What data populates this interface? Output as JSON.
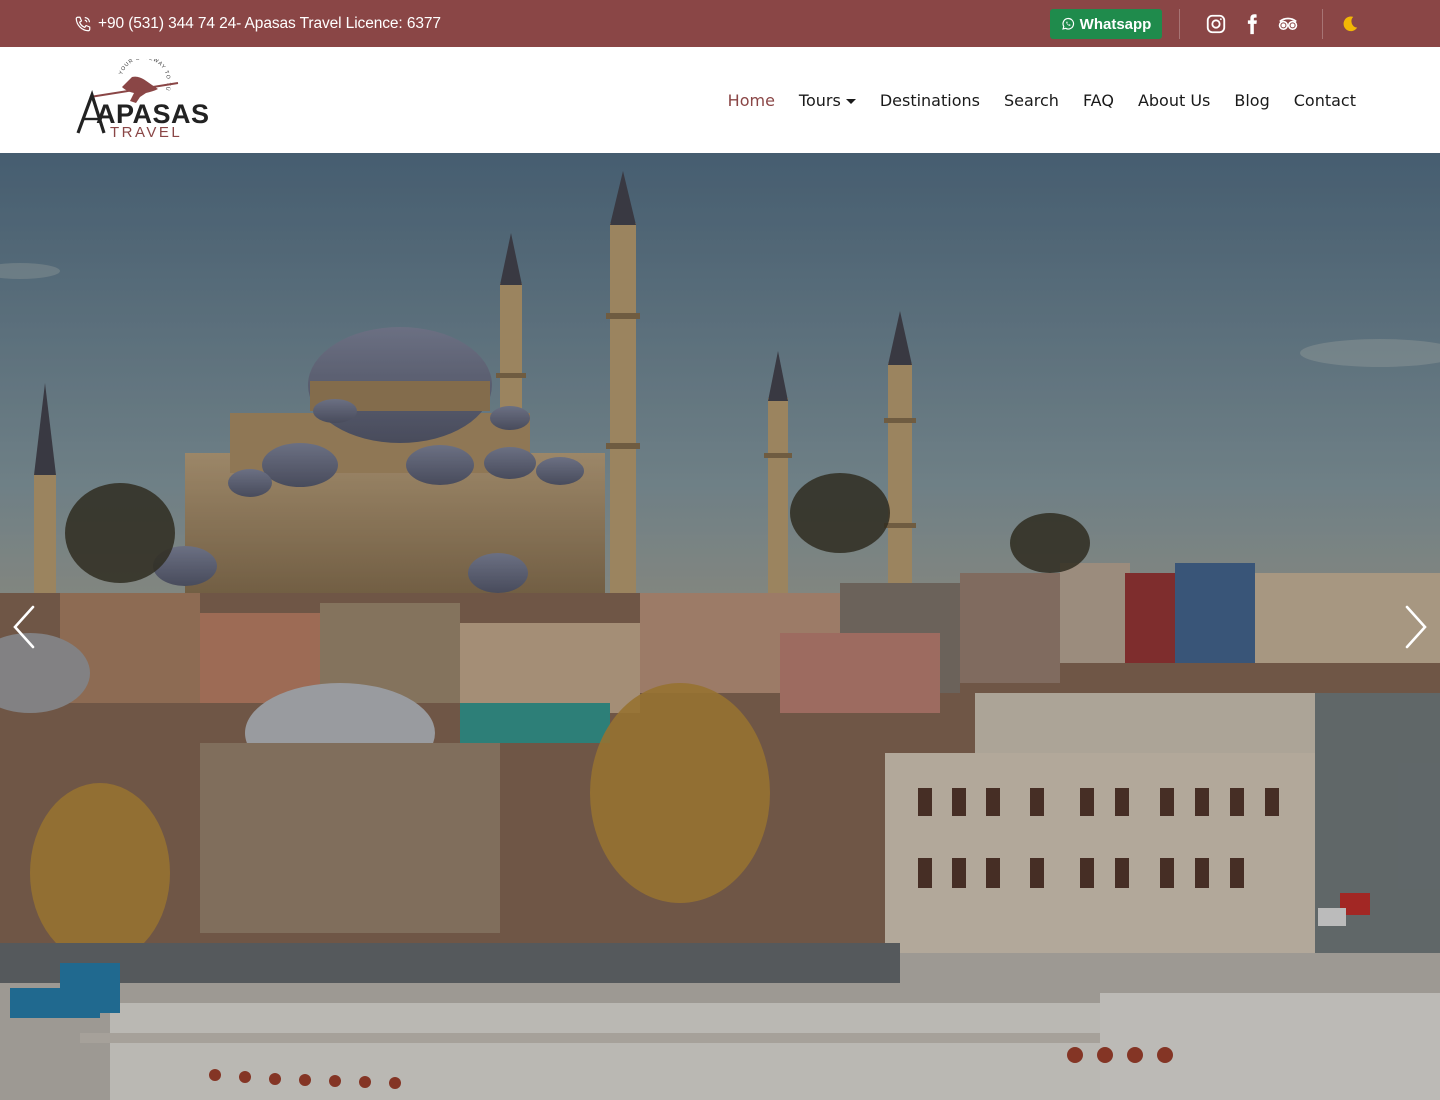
{
  "topbar": {
    "contact_text": "+90 (531) 344 74 24- Apasas Travel Licence: 6377",
    "whatsapp_label": "Whatsapp",
    "background": "#8a4646",
    "whatsapp_color": "#1f8b4c",
    "social_icons": [
      "instagram-icon",
      "facebook-icon",
      "tripadvisor-icon"
    ],
    "theme_toggle_icon": "moon-icon"
  },
  "header": {
    "logo": {
      "main": "APASAS",
      "sub": "TRAVEL",
      "tagline": "YOUR GATEWAY TO TÜRKIYE"
    },
    "nav": [
      {
        "label": "Home",
        "active": true
      },
      {
        "label": "Tours",
        "has_dropdown": true
      },
      {
        "label": "Destinations"
      },
      {
        "label": "Search"
      },
      {
        "label": "FAQ"
      },
      {
        "label": "About Us"
      },
      {
        "label": "Blog"
      },
      {
        "label": "Contact"
      }
    ],
    "accent": "#8a4646"
  },
  "hero": {
    "image": "istanbul-suleymaniye-mosque-skyline",
    "controls": {
      "prev_icon": "chevron-left-icon",
      "next_icon": "chevron-right-icon"
    }
  }
}
